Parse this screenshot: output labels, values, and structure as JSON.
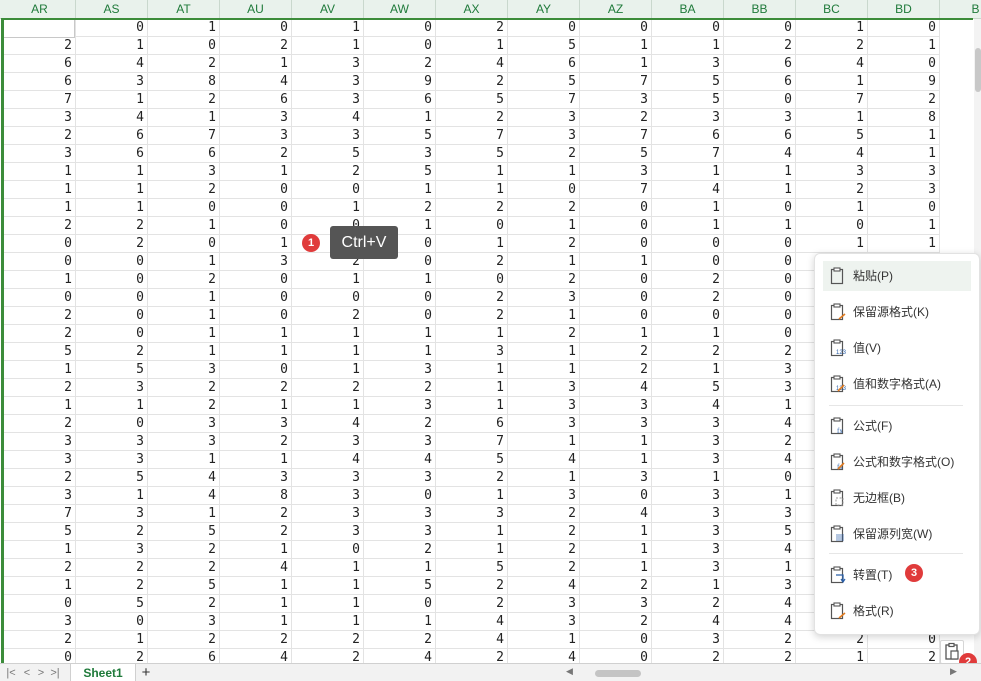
{
  "columns": [
    "AR",
    "AS",
    "AT",
    "AU",
    "AV",
    "AW",
    "AX",
    "AY",
    "AZ",
    "BA",
    "BB",
    "BC",
    "BD",
    "B"
  ],
  "rows": [
    [
      0,
      0,
      1,
      0,
      1,
      0,
      2,
      0,
      0,
      0,
      0,
      1,
      0
    ],
    [
      2,
      1,
      0,
      2,
      1,
      0,
      1,
      5,
      1,
      1,
      2,
      2,
      1
    ],
    [
      6,
      4,
      2,
      1,
      3,
      2,
      4,
      6,
      1,
      3,
      6,
      4,
      0
    ],
    [
      6,
      3,
      8,
      4,
      3,
      9,
      2,
      5,
      7,
      5,
      6,
      1,
      9
    ],
    [
      7,
      1,
      2,
      6,
      3,
      6,
      5,
      7,
      3,
      5,
      0,
      7,
      2
    ],
    [
      3,
      4,
      1,
      3,
      4,
      1,
      2,
      3,
      2,
      3,
      3,
      1,
      8
    ],
    [
      2,
      6,
      7,
      3,
      3,
      5,
      7,
      3,
      7,
      6,
      6,
      5,
      1
    ],
    [
      3,
      6,
      6,
      2,
      5,
      3,
      5,
      2,
      5,
      7,
      4,
      4,
      1
    ],
    [
      1,
      1,
      3,
      1,
      2,
      5,
      1,
      1,
      3,
      1,
      1,
      3,
      3
    ],
    [
      1,
      1,
      2,
      0,
      0,
      1,
      1,
      0,
      7,
      4,
      1,
      2,
      3
    ],
    [
      1,
      1,
      0,
      0,
      1,
      2,
      2,
      2,
      0,
      1,
      0,
      1,
      0
    ],
    [
      2,
      2,
      1,
      0,
      0,
      1,
      0,
      1,
      0,
      1,
      1,
      0,
      1
    ],
    [
      0,
      2,
      0,
      1,
      0,
      0,
      1,
      2,
      0,
      0,
      0,
      1,
      1
    ],
    [
      0,
      0,
      1,
      3,
      2,
      0,
      2,
      1,
      1,
      0,
      0,
      "",
      ""
    ],
    [
      1,
      0,
      2,
      0,
      1,
      1,
      0,
      2,
      0,
      2,
      0,
      "",
      ""
    ],
    [
      0,
      0,
      1,
      0,
      0,
      0,
      2,
      3,
      0,
      2,
      0,
      "",
      ""
    ],
    [
      2,
      0,
      1,
      0,
      2,
      0,
      2,
      1,
      0,
      0,
      0,
      "",
      ""
    ],
    [
      2,
      0,
      1,
      1,
      1,
      1,
      1,
      2,
      1,
      1,
      0,
      "",
      ""
    ],
    [
      5,
      2,
      1,
      1,
      1,
      1,
      3,
      1,
      2,
      2,
      2,
      "",
      ""
    ],
    [
      1,
      5,
      3,
      0,
      1,
      3,
      1,
      1,
      2,
      1,
      3,
      "",
      ""
    ],
    [
      2,
      3,
      2,
      2,
      2,
      2,
      1,
      3,
      4,
      5,
      3,
      "",
      ""
    ],
    [
      1,
      1,
      2,
      1,
      1,
      3,
      1,
      3,
      3,
      4,
      1,
      "",
      ""
    ],
    [
      2,
      0,
      3,
      3,
      4,
      2,
      6,
      3,
      3,
      3,
      4,
      "",
      ""
    ],
    [
      3,
      3,
      3,
      2,
      3,
      3,
      7,
      1,
      1,
      3,
      2,
      "",
      ""
    ],
    [
      3,
      3,
      1,
      1,
      4,
      4,
      5,
      4,
      1,
      3,
      4,
      "",
      ""
    ],
    [
      2,
      5,
      4,
      3,
      3,
      3,
      2,
      1,
      3,
      1,
      0,
      "",
      ""
    ],
    [
      3,
      1,
      4,
      8,
      3,
      0,
      1,
      3,
      0,
      3,
      1,
      "",
      ""
    ],
    [
      7,
      3,
      1,
      2,
      3,
      3,
      3,
      2,
      4,
      3,
      3,
      "",
      ""
    ],
    [
      5,
      2,
      5,
      2,
      3,
      3,
      1,
      2,
      1,
      3,
      5,
      "",
      ""
    ],
    [
      1,
      3,
      2,
      1,
      0,
      2,
      1,
      2,
      1,
      3,
      4,
      "",
      ""
    ],
    [
      2,
      2,
      2,
      4,
      1,
      1,
      5,
      2,
      1,
      3,
      1,
      "",
      ""
    ],
    [
      1,
      2,
      5,
      1,
      1,
      5,
      2,
      4,
      2,
      1,
      3,
      "",
      ""
    ],
    [
      0,
      5,
      2,
      1,
      1,
      0,
      2,
      3,
      3,
      2,
      4,
      "",
      ""
    ],
    [
      3,
      0,
      3,
      1,
      1,
      1,
      4,
      3,
      2,
      4,
      4,
      "",
      ""
    ],
    [
      2,
      1,
      2,
      2,
      2,
      2,
      4,
      1,
      0,
      3,
      2,
      2,
      0
    ],
    [
      0,
      2,
      6,
      4,
      2,
      4,
      2,
      4,
      0,
      2,
      2,
      1,
      2
    ]
  ],
  "tooltip": {
    "text": "Ctrl+V",
    "step": "1"
  },
  "step2": "2",
  "step3": "3",
  "menu": {
    "items": [
      {
        "label": "粘贴(P)",
        "icon": "paste-icon"
      },
      {
        "label": "保留源格式(K)",
        "icon": "paste-keep-format-icon"
      },
      {
        "label": "值(V)",
        "icon": "paste-values-icon"
      },
      {
        "label": "值和数字格式(A)",
        "icon": "paste-values-number-format-icon"
      },
      {
        "label": "公式(F)",
        "icon": "paste-formula-icon"
      },
      {
        "label": "公式和数字格式(O)",
        "icon": "paste-formula-number-format-icon"
      },
      {
        "label": "无边框(B)",
        "icon": "paste-no-border-icon"
      },
      {
        "label": "保留源列宽(W)",
        "icon": "paste-keep-width-icon"
      },
      {
        "label": "转置(T)",
        "icon": "paste-transpose-icon"
      },
      {
        "label": "格式(R)",
        "icon": "paste-format-icon"
      }
    ]
  },
  "sheet": {
    "tab": "Sheet1",
    "add_label": "+"
  },
  "nav": {
    "first": "|<",
    "prev": "<",
    "next": ">",
    "last": ">|"
  },
  "colors": {
    "accent": "#1f7a3a",
    "selection": "#3c8c3a",
    "badge": "#e03b3b"
  }
}
